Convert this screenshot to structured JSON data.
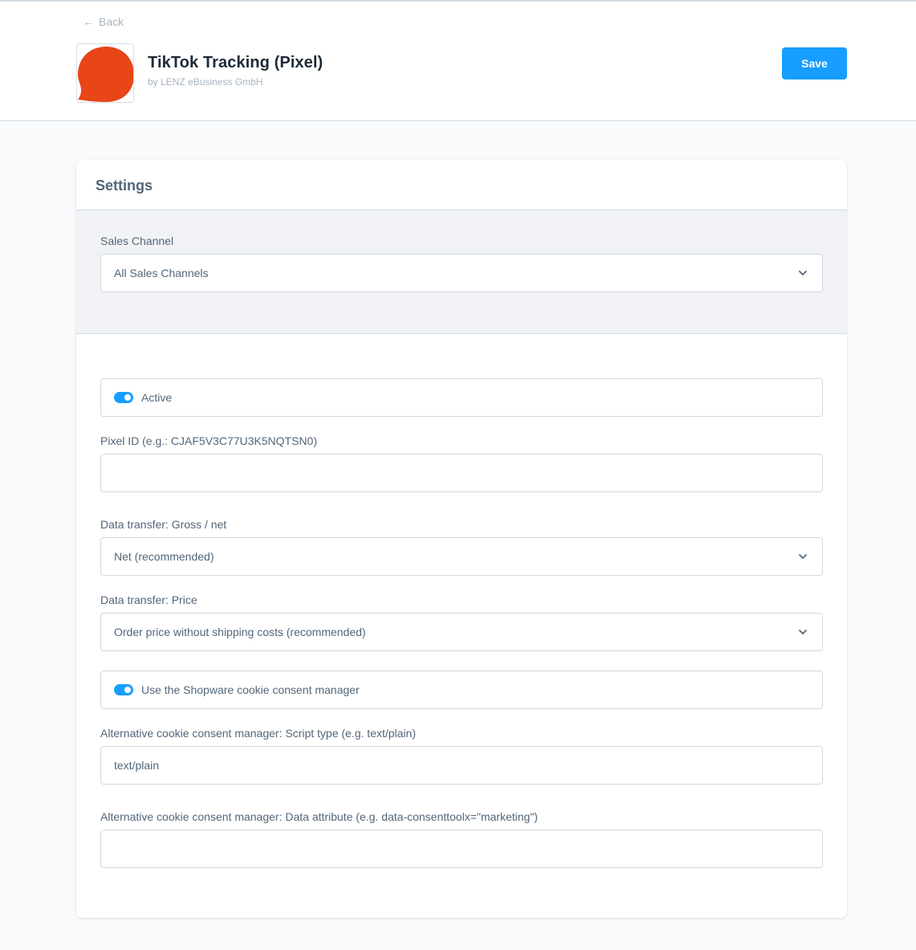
{
  "header": {
    "back_label": "Back",
    "app_title": "TikTok Tracking (Pixel)",
    "app_author": "by LENZ eBusiness GmbH",
    "save_label": "Save"
  },
  "colors": {
    "accent": "#189eff",
    "logo": "#e84518"
  },
  "settings": {
    "title": "Settings",
    "sales_channel": {
      "label": "Sales Channel",
      "value": "All Sales Channels"
    },
    "active": {
      "label": "Active",
      "enabled": true
    },
    "pixel_id": {
      "label": "Pixel ID (e.g.: CJAF5V3C77U3K5NQTSN0)",
      "value": ""
    },
    "gross_net": {
      "label": "Data transfer: Gross / net",
      "value": "Net (recommended)"
    },
    "price": {
      "label": "Data transfer: Price",
      "value": "Order price without shipping costs (recommended)"
    },
    "cookie_manager": {
      "label": "Use the Shopware cookie consent manager",
      "enabled": true
    },
    "script_type": {
      "label": "Alternative cookie consent manager: Script type (e.g. text/plain)",
      "value": "text/plain"
    },
    "data_attribute": {
      "label": "Alternative cookie consent manager: Data attribute (e.g. data-consenttoolx=\"marketing\")",
      "value": ""
    }
  }
}
